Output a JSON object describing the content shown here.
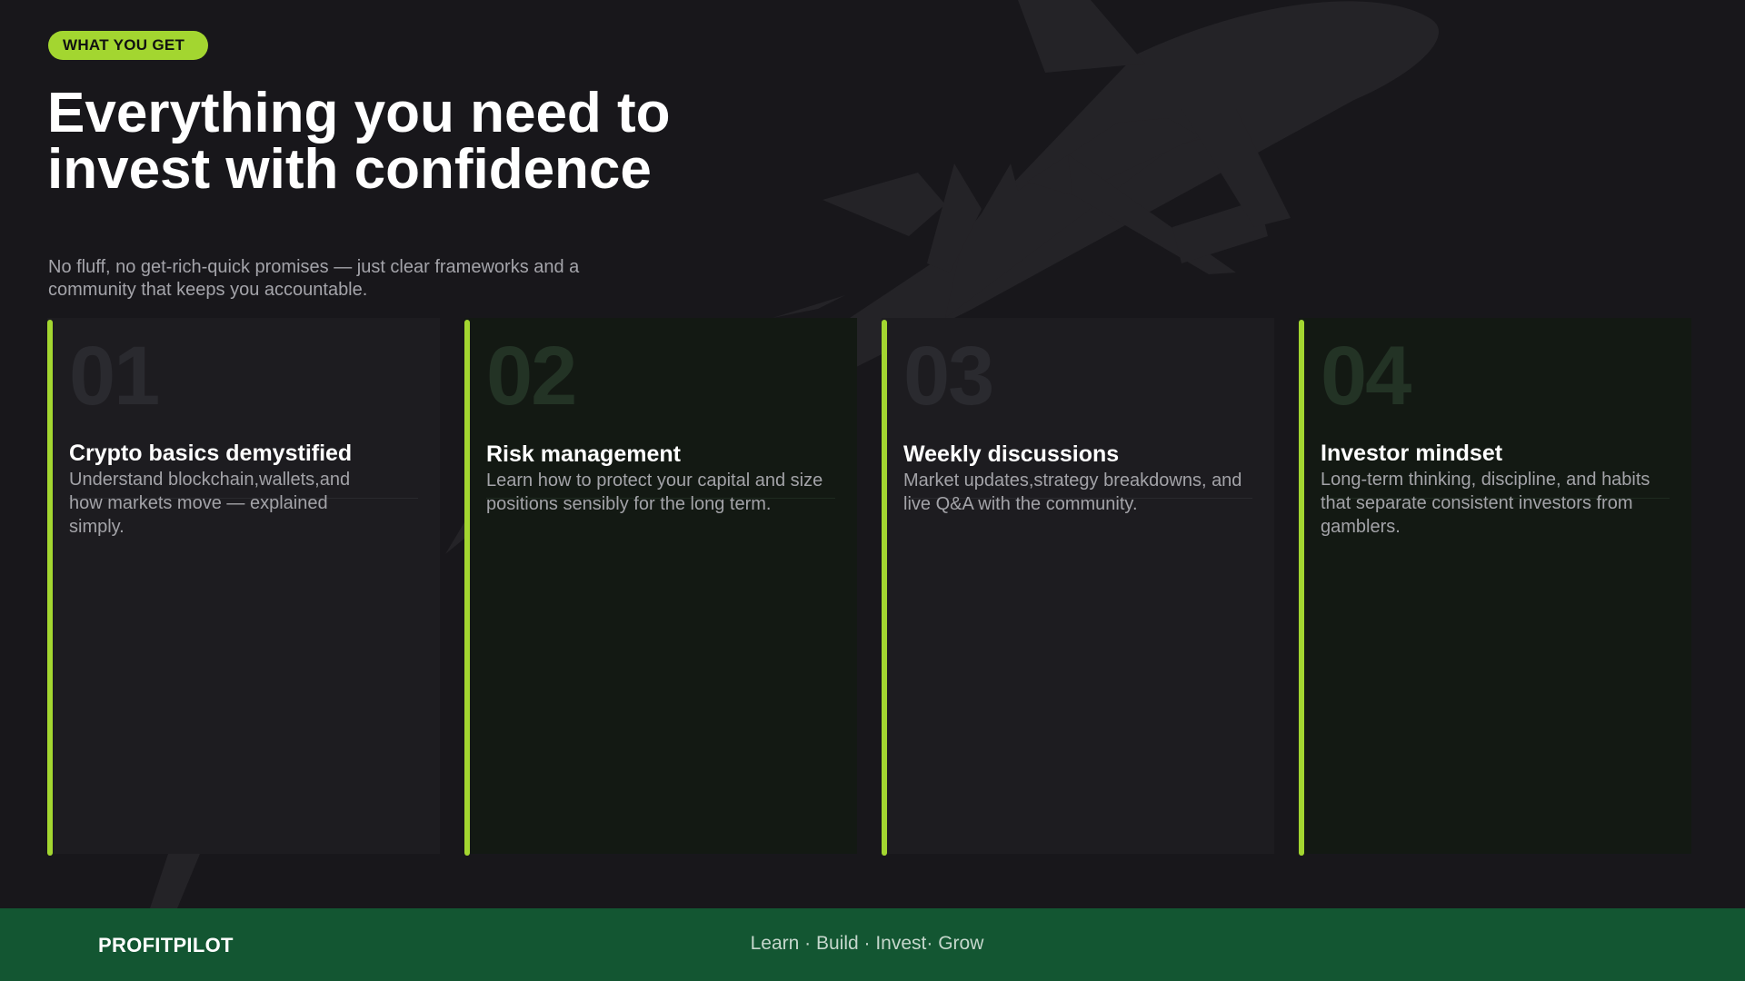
{
  "badge": "WHAT YOU GET",
  "hero": {
    "title": "Everything you need to invest with confidence",
    "subtitle": "No fluff, no get-rich-quick promises — just clear frameworks and a community that keeps you accountable."
  },
  "cards": [
    {
      "number": "01",
      "title": "Crypto basics demystified",
      "description": "Understand blockchain,wallets,and how markets move — explained simply."
    },
    {
      "number": "02",
      "title": "Risk management",
      "description": "Learn how to protect your capital and size positions sensibly for the long term."
    },
    {
      "number": "03",
      "title": "Weekly discussions",
      "description": "Market updates,strategy breakdowns, and live Q&A with the community."
    },
    {
      "number": "04",
      "title": "Investor mindset",
      "description": "Long-term thinking, discipline, and habits that separate consistent investors from gamblers."
    }
  ],
  "footer": {
    "brand": "PROFITPILOT",
    "tagline": "Learn · Build · Invest· Grow"
  },
  "colors": {
    "background": "#18171b",
    "accent": "#a3d630",
    "footer": "#135632",
    "card": "#1d1c20",
    "card_alt": "#131913"
  },
  "icons": {
    "background_graphic": "airplane-icon"
  }
}
